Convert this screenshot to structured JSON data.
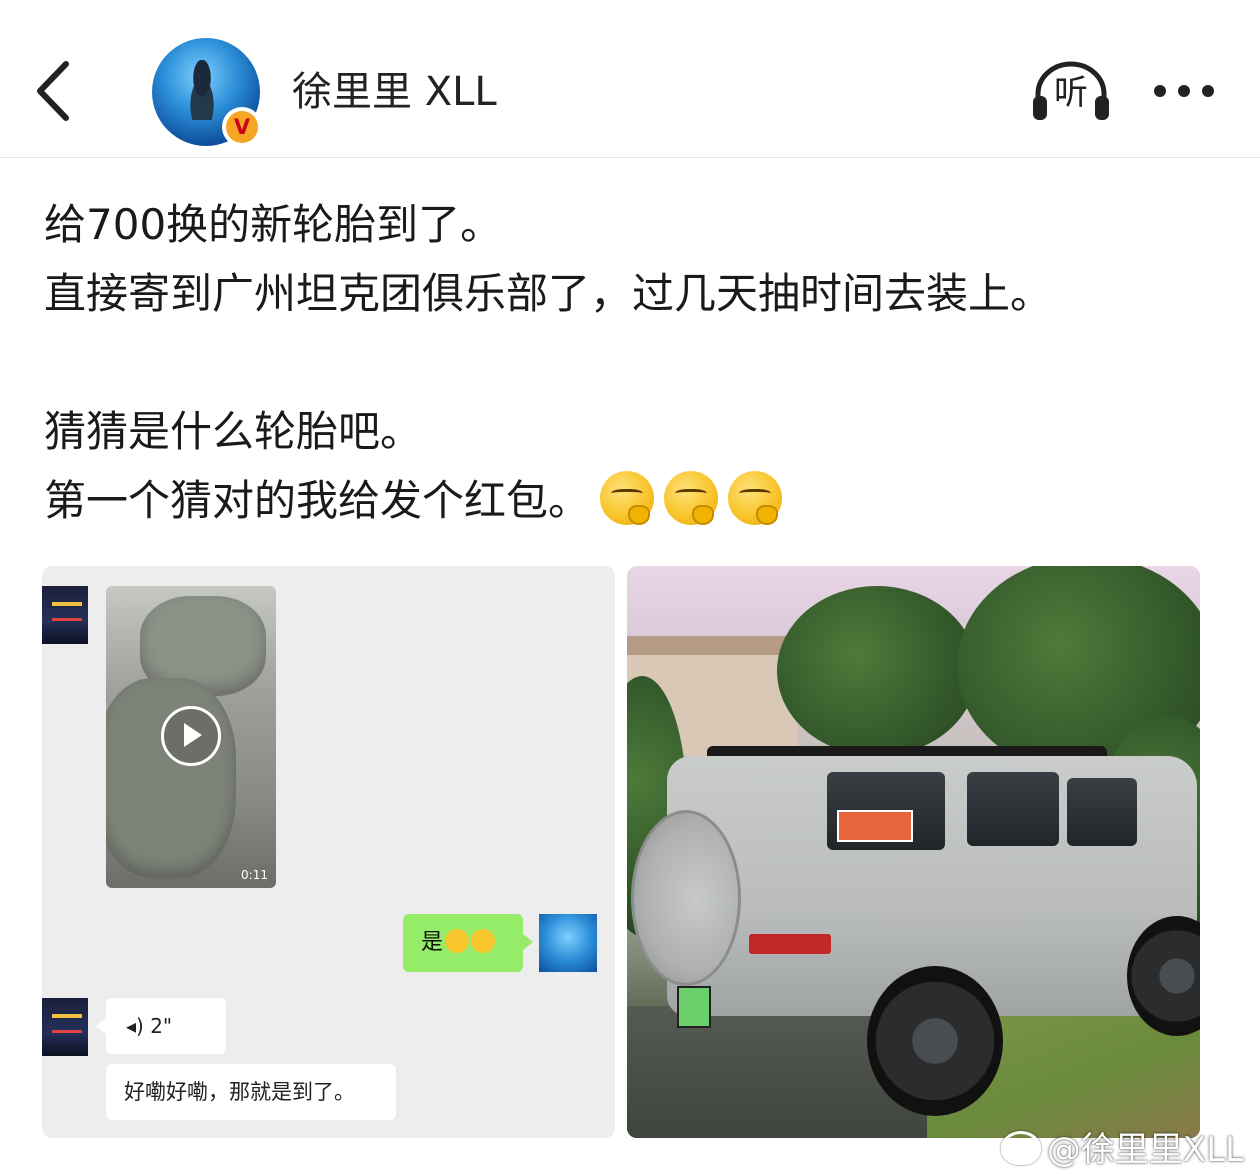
{
  "header": {
    "username": "徐里里 XLL",
    "listen_label": "听"
  },
  "post": {
    "lines": [
      "给700换的新轮胎到了。",
      "直接寄到广州坦克团俱乐部了，过几天抽时间去装上。",
      "",
      "猜猜是什么轮胎吧。",
      "第一个猜对的我给发个红包。"
    ]
  },
  "chat_screenshot": {
    "video_duration": "0:11",
    "my_message": "是",
    "voice_duration": "2\"",
    "reply_message": "好嘞好嘞，那就是到了。"
  },
  "watermark": "@徐里里XLL",
  "icons": {
    "back": "back-chevron-icon",
    "listen": "headphones-listen-icon",
    "more": "more-dots-icon",
    "verified": "verified-v-badge-icon",
    "emoji": "thinking-face-emoji-icon",
    "play": "play-icon",
    "voice": "voice-wave-icon"
  }
}
